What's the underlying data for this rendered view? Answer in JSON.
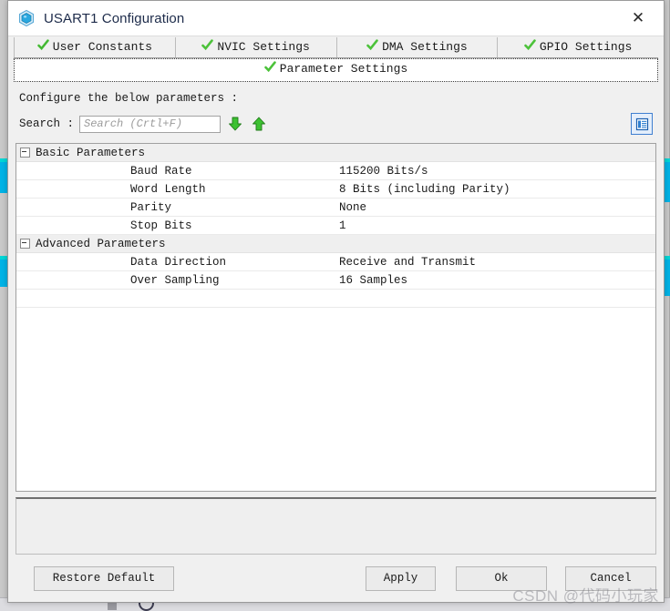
{
  "window": {
    "title": "USART1 Configuration",
    "icon": "cube-icon",
    "close_label": "✕"
  },
  "tabs": {
    "row1": [
      {
        "label": "User Constants",
        "icon": "green-check-icon",
        "selected": false
      },
      {
        "label": "NVIC Settings",
        "icon": "green-check-icon",
        "selected": false
      },
      {
        "label": "DMA Settings",
        "icon": "green-check-icon",
        "selected": false
      },
      {
        "label": "GPIO Settings",
        "icon": "green-check-icon",
        "selected": false
      }
    ],
    "row2": [
      {
        "label": "Parameter Settings",
        "icon": "green-check-icon",
        "selected": true
      }
    ]
  },
  "main": {
    "instruction": "Configure the below parameters :",
    "search": {
      "label": "Search :",
      "value": "",
      "placeholder": "Search (Crtl+F)",
      "find_next_icon": "arrow-down-icon",
      "find_prev_icon": "arrow-up-icon"
    },
    "view_toggle_icon": "list-view-icon",
    "groups": [
      {
        "name": "Basic Parameters",
        "expanded": true,
        "rows": [
          {
            "name": "Baud Rate",
            "value": "115200 Bits/s"
          },
          {
            "name": "Word Length",
            "value": "8 Bits (including Parity)"
          },
          {
            "name": "Parity",
            "value": "None"
          },
          {
            "name": "Stop Bits",
            "value": "1"
          }
        ]
      },
      {
        "name": "Advanced Parameters",
        "expanded": true,
        "rows": [
          {
            "name": "Data Direction",
            "value": "Receive and Transmit"
          },
          {
            "name": "Over Sampling",
            "value": "16 Samples"
          }
        ]
      }
    ],
    "description_panel_text": ""
  },
  "footer": {
    "restore_label": "Restore Default",
    "apply_label": "Apply",
    "ok_label": "Ok",
    "cancel_label": "Cancel"
  },
  "watermark": {
    "text": "CSDN @代码小玩家"
  },
  "colors": {
    "accent_blue": "#3f7fd0",
    "check_green": "#4cc23a",
    "pin_cyan": "#00b3e6",
    "title_text": "#1d2b4a"
  }
}
